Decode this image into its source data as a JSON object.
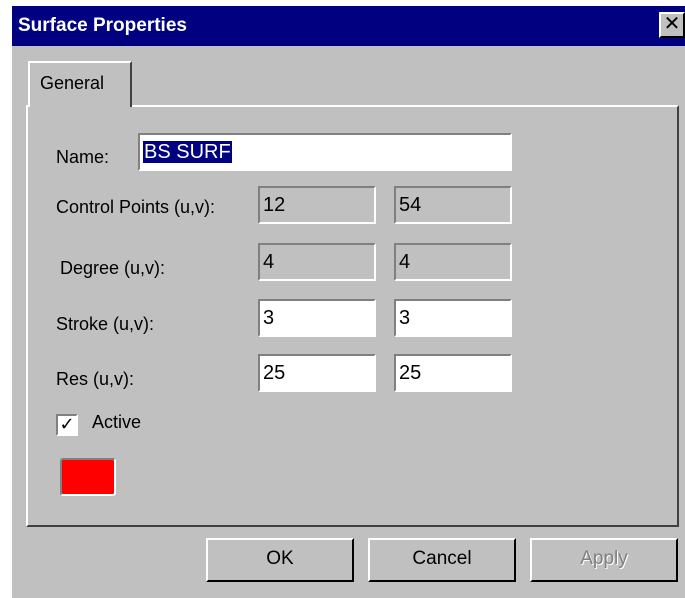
{
  "window": {
    "title": "Surface Properties",
    "close_glyph": "✕"
  },
  "tabs": [
    {
      "label": "General"
    }
  ],
  "form": {
    "name_label": "Name:",
    "name_value": "BS SURF",
    "control_points_label": "Control Points (u,v):",
    "control_points_u": "12",
    "control_points_v": "54",
    "degree_label": "Degree (u,v):",
    "degree_u": "4",
    "degree_v": "4",
    "stroke_label": "Stroke (u,v):",
    "stroke_u": "3",
    "stroke_v": "3",
    "res_label": "Res (u,v):",
    "res_u": "25",
    "res_v": "25",
    "active_label": "Active",
    "active_checked": true,
    "active_glyph": "✓",
    "color": "#ff0000"
  },
  "buttons": {
    "ok": "OK",
    "cancel": "Cancel",
    "apply": "Apply"
  }
}
